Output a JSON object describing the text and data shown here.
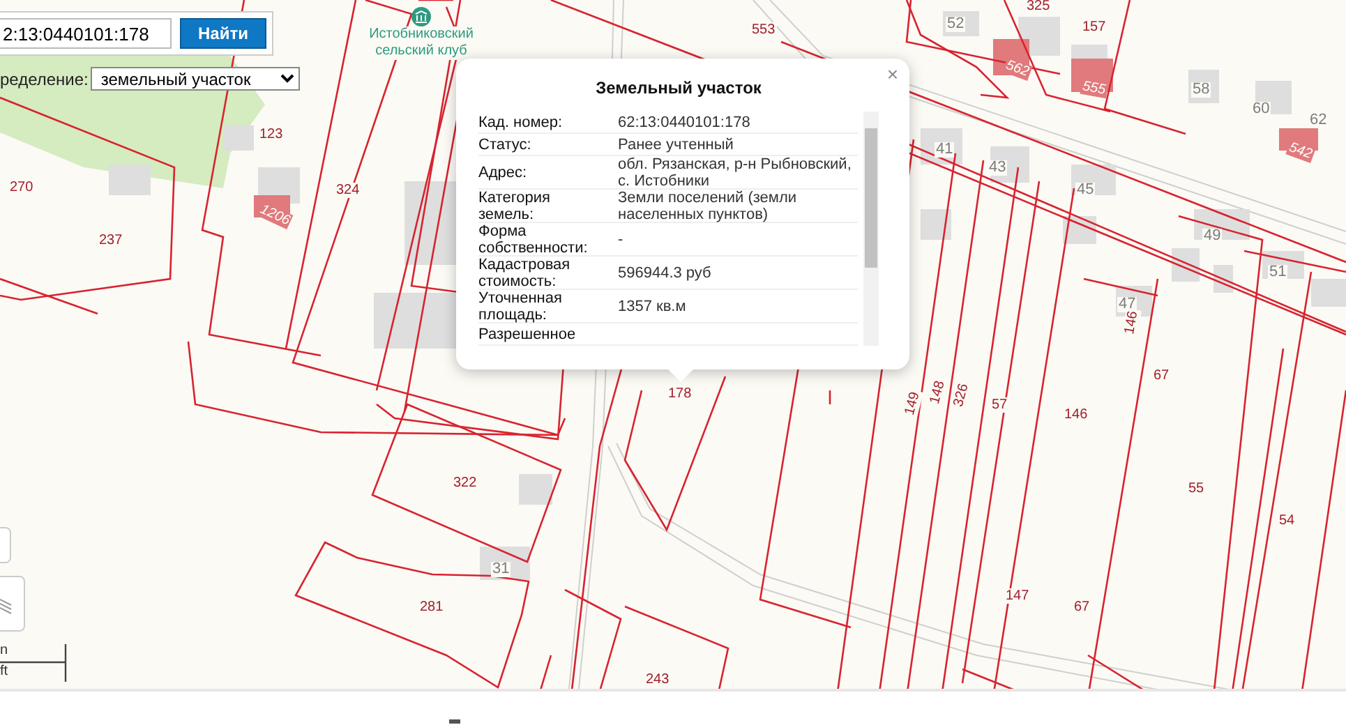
{
  "search": {
    "value": "2:13:0440101:178",
    "button": "Найти"
  },
  "filter": {
    "label": "ределение:",
    "value": "земельный участок"
  },
  "poi": {
    "name": "Истобниковский сельский клуб"
  },
  "popup": {
    "title": "Земельный участок",
    "close": "×",
    "rows": [
      {
        "label": "Кад. номер:",
        "value": "62:13:0440101:178"
      },
      {
        "label": "Статус:",
        "value": "Ранее учтенный"
      },
      {
        "label": "Адрес:",
        "value": "обл. Рязанская, р-н Рыбновский, с. Истобники"
      },
      {
        "label": "Категория земель:",
        "value": "Земли поселений (земли населенных пунктов)"
      },
      {
        "label": "Форма собственности:",
        "value": "-"
      },
      {
        "label": "Кадастровая стоимость:",
        "value": "596944.3 руб"
      },
      {
        "label": "Уточненная площадь:",
        "value": "1357 кв.м"
      },
      {
        "label": "Разрешенное"
      }
    ]
  },
  "map_labels": [
    {
      "text": "270",
      "kind": "parcel"
    },
    {
      "text": "237",
      "kind": "parcel"
    },
    {
      "text": "123",
      "kind": "parcel"
    },
    {
      "text": "1206",
      "kind": "building"
    },
    {
      "text": "324",
      "kind": "parcel"
    },
    {
      "text": "553",
      "kind": "parcel"
    },
    {
      "text": "52",
      "kind": "house"
    },
    {
      "text": "325",
      "kind": "parcel"
    },
    {
      "text": "157",
      "kind": "parcel"
    },
    {
      "text": "562",
      "kind": "building"
    },
    {
      "text": "555",
      "kind": "building"
    },
    {
      "text": "58",
      "kind": "house"
    },
    {
      "text": "60",
      "kind": "house"
    },
    {
      "text": "62",
      "kind": "house"
    },
    {
      "text": "542",
      "kind": "building"
    },
    {
      "text": "41",
      "kind": "house"
    },
    {
      "text": "43",
      "kind": "house"
    },
    {
      "text": "45",
      "kind": "house"
    },
    {
      "text": "47",
      "kind": "house"
    },
    {
      "text": "146",
      "kind": "parcel"
    },
    {
      "text": "49",
      "kind": "house"
    },
    {
      "text": "51",
      "kind": "house"
    },
    {
      "text": "67",
      "kind": "parcel"
    },
    {
      "text": "146",
      "kind": "parcel"
    },
    {
      "text": "57",
      "kind": "parcel"
    },
    {
      "text": "326",
      "kind": "parcel"
    },
    {
      "text": "148",
      "kind": "parcel"
    },
    {
      "text": "149",
      "kind": "parcel"
    },
    {
      "text": "178",
      "kind": "parcel"
    },
    {
      "text": "322",
      "kind": "parcel"
    },
    {
      "text": "31",
      "kind": "house"
    },
    {
      "text": "281",
      "kind": "parcel"
    },
    {
      "text": "243",
      "kind": "parcel"
    },
    {
      "text": "147",
      "kind": "parcel"
    },
    {
      "text": "67",
      "kind": "parcel"
    },
    {
      "text": "55",
      "kind": "parcel"
    },
    {
      "text": "54",
      "kind": "parcel"
    }
  ],
  "scale": [
    "n",
    "ft"
  ]
}
